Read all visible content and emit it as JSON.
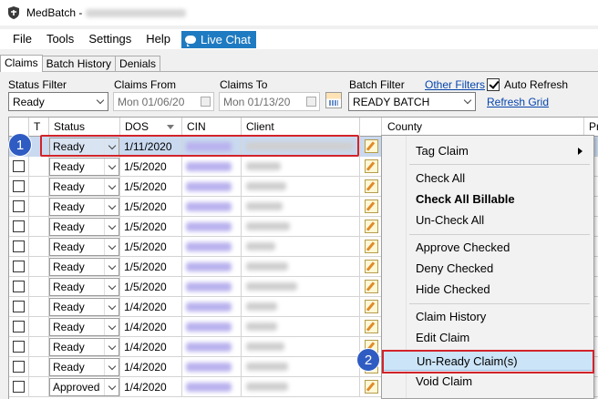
{
  "window": {
    "title": "MedBatch -"
  },
  "menu": {
    "file": "File",
    "tools": "Tools",
    "settings": "Settings",
    "help": "Help",
    "live_chat": "Live Chat"
  },
  "tabs": [
    "Claims",
    "Batch History",
    "Denials"
  ],
  "filters": {
    "status_filter_label": "Status Filter",
    "status_filter_value": "Ready",
    "claims_from_label": "Claims From",
    "claims_from_value": "Mon 01/06/20",
    "claims_to_label": "Claims To",
    "claims_to_value": "Mon 01/13/20",
    "batch_filter_label": "Batch Filter",
    "batch_filter_value": "READY BATCH",
    "other_filters": "Other Filters",
    "auto_refresh": "Auto Refresh",
    "refresh_grid": "Refresh Grid"
  },
  "grid": {
    "columns": {
      "t": "T",
      "status": "Status",
      "dos": "DOS",
      "cin": "CIN",
      "client": "Client",
      "county": "County",
      "price": "Pric"
    },
    "rows": [
      {
        "status": "Ready",
        "dos": "1/11/2020"
      },
      {
        "status": "Ready",
        "dos": "1/5/2020"
      },
      {
        "status": "Ready",
        "dos": "1/5/2020"
      },
      {
        "status": "Ready",
        "dos": "1/5/2020"
      },
      {
        "status": "Ready",
        "dos": "1/5/2020"
      },
      {
        "status": "Ready",
        "dos": "1/5/2020"
      },
      {
        "status": "Ready",
        "dos": "1/5/2020"
      },
      {
        "status": "Ready",
        "dos": "1/5/2020"
      },
      {
        "status": "Ready",
        "dos": "1/4/2020"
      },
      {
        "status": "Ready",
        "dos": "1/4/2020"
      },
      {
        "status": "Ready",
        "dos": "1/4/2020"
      },
      {
        "status": "Ready",
        "dos": "1/4/2020"
      },
      {
        "status": "Approved",
        "dos": "1/4/2020"
      }
    ]
  },
  "context_menu": {
    "tag_claim": "Tag Claim",
    "check_all": "Check All",
    "check_all_billable": "Check All Billable",
    "uncheck_all": "Un-Check All",
    "approve_checked": "Approve Checked",
    "deny_checked": "Deny Checked",
    "hide_checked": "Hide Checked",
    "claim_history": "Claim History",
    "edit_claim": "Edit Claim",
    "unready_claims": "Un-Ready Claim(s)",
    "void_claim": "Void Claim"
  },
  "annotations": {
    "step1": "1",
    "step2": "2"
  },
  "colors": {
    "accent": "#1f7bc1",
    "highlight_box": "#d2232a",
    "badge": "#2f5cc2"
  }
}
